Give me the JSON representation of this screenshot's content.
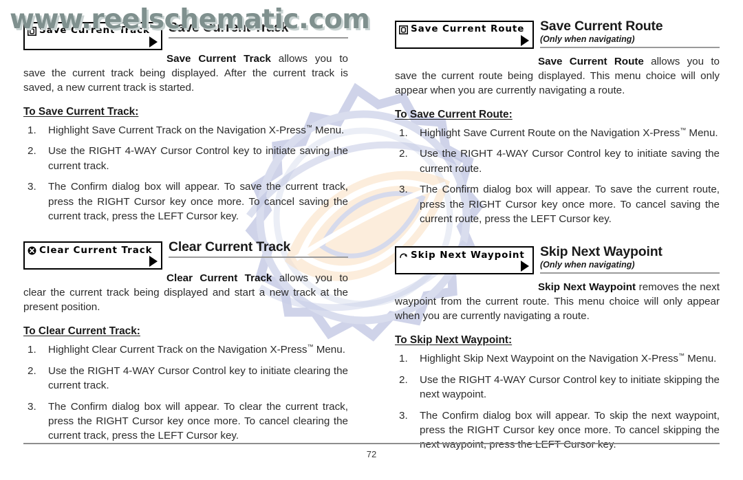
{
  "watermark": {
    "text": "www.reelschematic.com",
    "color": "#7f908e",
    "shadow_color": "#c9d3d2"
  },
  "background_emblem": {
    "name": "gear-compass-fish-emblem",
    "colors": [
      "#b8bedd",
      "#ccd2e6",
      "#fadfc0",
      "#e8eef6"
    ]
  },
  "footer": {
    "page_number": "72",
    "rule_color": "#8d8d8d"
  },
  "columns": [
    {
      "sections": [
        {
          "chip": {
            "label": "Save Current Track",
            "icon": "save-box-icon",
            "arrow": "right-triangle-icon"
          },
          "title": "Save Current Track",
          "subtitle": "",
          "intro_bold": "Save Current Track",
          "intro_rest": " allows you to save the current track being displayed. After the current track is saved, a new current track is started.",
          "lead_in": "To Save Current Track:",
          "steps": [
            {
              "num": "1.",
              "text": "Highlight Save Current Track on the Navigation X-Press™ Menu."
            },
            {
              "num": "2.",
              "text": "Use the RIGHT 4-WAY Cursor Control key to initiate saving the current track."
            },
            {
              "num": "3.",
              "text": "The Confirm dialog box will appear. To save the current track, press the RIGHT Cursor key once more. To cancel saving the current track, press the LEFT Cursor key."
            }
          ]
        },
        {
          "chip": {
            "label": "Clear Current Track",
            "icon": "circle-x-icon",
            "arrow": "right-triangle-icon"
          },
          "title": "Clear Current Track",
          "subtitle": "",
          "intro_bold": "Clear Current Track",
          "intro_rest": " allows you to clear the current track being displayed and start a new track at the present position.",
          "lead_in": "To Clear Current Track:",
          "steps": [
            {
              "num": "1.",
              "text": "Highlight Clear Current Track on the Navigation X-Press™ Menu."
            },
            {
              "num": "2.",
              "text": "Use the RIGHT 4-WAY Cursor Control key to initiate clearing the current track."
            },
            {
              "num": "3.",
              "text": "The Confirm dialog box will appear. To clear the current track, press the RIGHT Cursor key once more. To cancel clearing the current track, press the LEFT Cursor key."
            }
          ]
        }
      ]
    },
    {
      "sections": [
        {
          "chip": {
            "label": "Save Current Route",
            "icon": "save-box-icon",
            "arrow": "right-triangle-icon"
          },
          "title": "Save Current Route",
          "subtitle": "(Only when navigating)",
          "intro_bold": "Save Current Route",
          "intro_rest": " allows you to save the current route being displayed. This menu choice will only appear when you are currently navigating a route.",
          "lead_in": "To Save Current Route:",
          "steps": [
            {
              "num": "1.",
              "text": "Highlight Save Current Route on the Navigation X-Press™ Menu."
            },
            {
              "num": "2.",
              "text": "Use the RIGHT 4-WAY Cursor Control key to initiate saving the current route."
            },
            {
              "num": "3.",
              "text": "The Confirm dialog box will appear. To save the current route, press the RIGHT Cursor key once more. To cancel saving the current route, press the LEFT Cursor key."
            }
          ]
        },
        {
          "chip": {
            "label": "Skip Next Waypoint",
            "icon": "skip-arc-arrow-icon",
            "arrow": "right-triangle-icon"
          },
          "title": "Skip Next Waypoint",
          "subtitle": "(Only when navigating)",
          "intro_bold": "Skip Next Waypoint",
          "intro_rest": " removes the next waypoint from the current route. This menu choice will only appear when you are currently navigating a route.",
          "lead_in": "To Skip Next Waypoint:",
          "steps": [
            {
              "num": "1.",
              "text": "Highlight Skip Next Waypoint on the Navigation X-Press™ Menu."
            },
            {
              "num": "2.",
              "text": "Use the RIGHT 4-WAY Cursor Control key to initiate skipping the next waypoint."
            },
            {
              "num": "3.",
              "text": "The Confirm dialog box will appear. To skip the next waypoint, press the RIGHT Cursor key once more. To cancel skipping the next waypoint, press the LEFT Cursor key."
            }
          ]
        }
      ]
    }
  ]
}
